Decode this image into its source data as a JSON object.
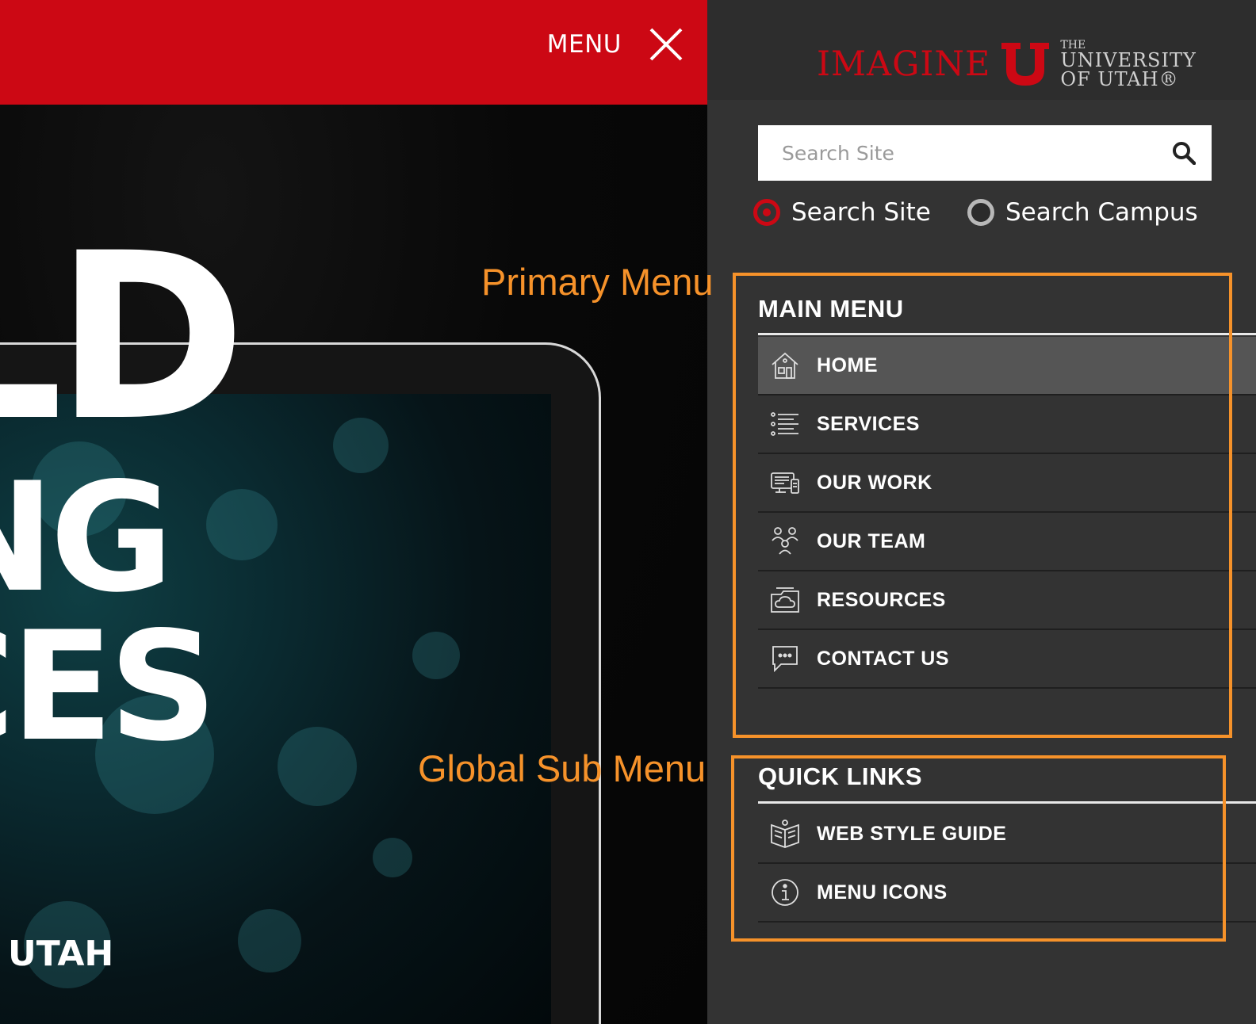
{
  "topbar": {
    "menu_label": "MENU",
    "accent": "#cc0814"
  },
  "hero": {
    "line1": "LD",
    "line2": "NG",
    "line3": "CES",
    "line4": "UTAH"
  },
  "logo": {
    "imagine": "IMAGINE",
    "the": "THE",
    "university": "UNIVERSITY",
    "of_utah": "OF UTAH®"
  },
  "search": {
    "placeholder": "Search Site",
    "icon": "search-icon",
    "options": [
      {
        "label": "Search Site",
        "selected": true
      },
      {
        "label": "Search Campus",
        "selected": false
      }
    ]
  },
  "main_menu": {
    "title": "MAIN MENU",
    "items": [
      {
        "label": "HOME",
        "icon": "home-icon",
        "active": true
      },
      {
        "label": "SERVICES",
        "icon": "list-icon"
      },
      {
        "label": "OUR WORK",
        "icon": "devices-icon"
      },
      {
        "label": "OUR TEAM",
        "icon": "team-icon"
      },
      {
        "label": "RESOURCES",
        "icon": "cloud-folder-icon"
      },
      {
        "label": "CONTACT US",
        "icon": "chat-bubble-icon"
      }
    ]
  },
  "quick_links": {
    "title": "QUICK LINKS",
    "items": [
      {
        "label": "WEB STYLE GUIDE",
        "icon": "style-guide-icon"
      },
      {
        "label": "MENU ICONS",
        "icon": "info-icon"
      }
    ]
  },
  "annotations": {
    "primary": "Primary Menu",
    "global": "Global Sub Menu",
    "color": "#f6922a"
  }
}
